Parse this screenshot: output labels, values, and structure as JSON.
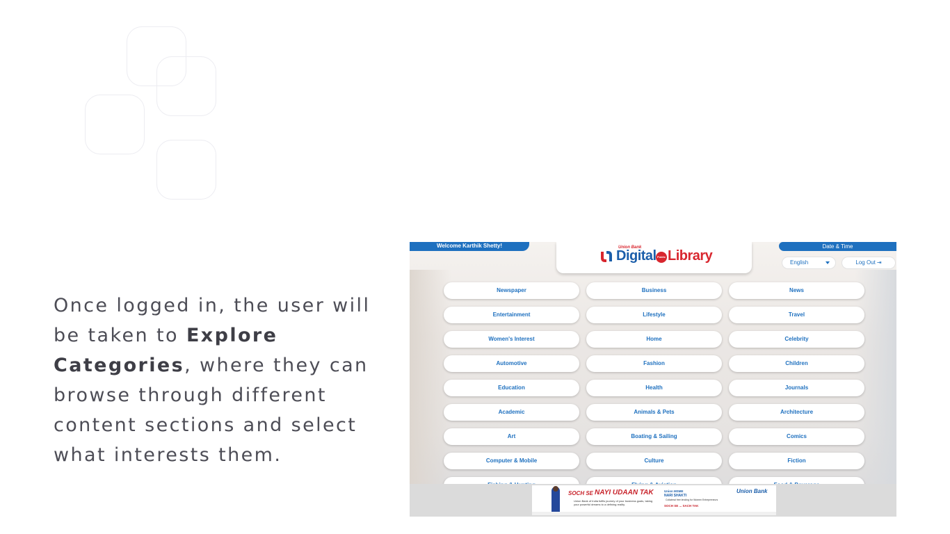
{
  "caption": {
    "part1": "Once logged in, the user will be taken to ",
    "bold": "Explore Categories",
    "part2": ", where they can browse through different content sections and select what interests them."
  },
  "app": {
    "welcome": "Welcome Karthik Shetty!",
    "datetime": "Date & Time",
    "logo": {
      "small": "Union Bank",
      "digital": "Digital",
      "public": "Public",
      "library": "Library"
    },
    "language": "English",
    "logout": "Log Out",
    "categories": [
      "Newspaper",
      "Business",
      "News",
      "Entertainment",
      "Lifestyle",
      "Travel",
      "Women's Interest",
      "Home",
      "Celebrity",
      "Automotive",
      "Fashion",
      "Children",
      "Education",
      "Health",
      "Journals",
      "Academic",
      "Animals & Pets",
      "Architecture",
      "Art",
      "Boating & Sailing",
      "Comics",
      "Computer & Mobile",
      "Culture",
      "Fiction",
      "Fishing & Hunting",
      "Flying & Aviation",
      "Food & Beverage"
    ],
    "banner": {
      "tag1": "SOCH SE",
      "tag2": "NAYI UDAAN TAK",
      "line1": "Union Bank of India fulfils journey of your business goals, taking your powerful dreams to a defining reality.",
      "nari1": "Union MSME",
      "nari2": "NARI SHAKTI",
      "nari3": "Collateral free lending for Women Entrepreneurs",
      "soch": "SOCH SE ... SACH TAK",
      "logo": "Union Bank"
    }
  },
  "colors": {
    "accent": "#1e70bf",
    "brand_red": "#d8262e",
    "caption_text": "#4d4d56"
  }
}
